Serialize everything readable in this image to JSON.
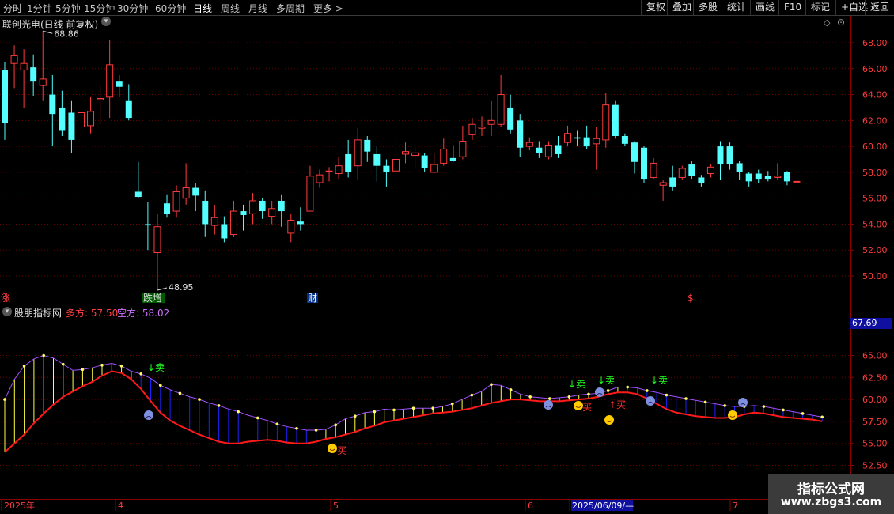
{
  "toolbar": {
    "periods": [
      "分时",
      "1分钟",
      "5分钟",
      "15分钟",
      "30分钟",
      "60分钟",
      "日线",
      "周线",
      "月线",
      "多周期",
      "更多 >"
    ],
    "active_period": "日线",
    "tools": [
      "复权",
      "叠加",
      "多股",
      "统计",
      "画线",
      "F10",
      "标记",
      "+自选",
      "返回"
    ]
  },
  "price_panel": {
    "title": "联创光电(日线 前复权)",
    "high_marker": "68.86",
    "low_marker": "48.95",
    "event_tags": [
      {
        "text": "涨",
        "color": "#ff3c3c"
      },
      {
        "text": "跌增",
        "color": "#e0e0e0"
      },
      {
        "text": "财",
        "color": "#ffffff"
      },
      {
        "text": "$",
        "color": "#ff3c3c"
      }
    ],
    "y_ticks": [
      "68.00",
      "66.00",
      "64.00",
      "62.00",
      "60.00",
      "58.00",
      "56.00",
      "54.00",
      "52.00",
      "50.00"
    ],
    "up_color": "#ff3c3c",
    "down_color": "#54ffff"
  },
  "indicator_panel": {
    "name": "股朋指标网",
    "long_label": "多方: 57.50",
    "short_label": "空方: 58.02",
    "current_value": "67.69",
    "y_ticks": [
      "65.00",
      "62.50",
      "60.00",
      "57.50",
      "55.00",
      "52.50"
    ],
    "buy_label": "买",
    "sell_label": "卖",
    "long_color": "#ff1a1a",
    "short_color": "#a050ff"
  },
  "date_axis": {
    "labels": [
      "2025年",
      "4",
      "5",
      "6",
      "2025/06/09/—",
      "7"
    ]
  },
  "watermark": {
    "line1": "指标公式网",
    "line2": "www.zbgs3.com"
  },
  "chart_data": {
    "type": "candlestick",
    "title": "联创光电(日线 前复权)",
    "ylim": [
      48.5,
      69.5
    ],
    "candles": [
      {
        "o": 65.9,
        "c": 61.8,
        "h": 66.5,
        "l": 60.5
      },
      {
        "o": 66.4,
        "c": 67.0,
        "h": 67.8,
        "l": 64.5
      },
      {
        "o": 65.9,
        "c": 66.4,
        "h": 67.5,
        "l": 63.0
      },
      {
        "o": 66.1,
        "c": 65.0,
        "h": 67.1,
        "l": 63.9
      },
      {
        "o": 64.7,
        "c": 65.2,
        "h": 68.9,
        "l": 63.5
      },
      {
        "o": 64.0,
        "c": 62.5,
        "h": 65.5,
        "l": 60.0
      },
      {
        "o": 63.0,
        "c": 61.2,
        "h": 64.3,
        "l": 60.8
      },
      {
        "o": 62.6,
        "c": 60.5,
        "h": 63.5,
        "l": 59.5
      },
      {
        "o": 61.5,
        "c": 62.6,
        "h": 63.5,
        "l": 60.5
      },
      {
        "o": 61.6,
        "c": 62.7,
        "h": 63.8,
        "l": 61.0
      },
      {
        "o": 63.6,
        "c": 63.7,
        "h": 64.7,
        "l": 61.7
      },
      {
        "o": 63.8,
        "c": 66.3,
        "h": 68.2,
        "l": 62.2
      },
      {
        "o": 65.0,
        "c": 64.6,
        "h": 65.5,
        "l": 63.8
      },
      {
        "o": 63.5,
        "c": 62.2,
        "h": 64.8,
        "l": 62.0
      },
      {
        "o": 56.5,
        "c": 56.1,
        "h": 58.8,
        "l": 56.0
      },
      {
        "o": 54.0,
        "c": 53.9,
        "h": 55.7,
        "l": 52.0
      },
      {
        "o": 51.8,
        "c": 53.8,
        "h": 54.8,
        "l": 48.9
      },
      {
        "o": 55.6,
        "c": 54.8,
        "h": 56.3,
        "l": 54.5
      },
      {
        "o": 55.0,
        "c": 56.5,
        "h": 57.0,
        "l": 54.5
      },
      {
        "o": 56.0,
        "c": 56.8,
        "h": 58.7,
        "l": 55.5
      },
      {
        "o": 56.8,
        "c": 56.2,
        "h": 57.2,
        "l": 55.0
      },
      {
        "o": 55.8,
        "c": 54.0,
        "h": 56.6,
        "l": 53.0
      },
      {
        "o": 53.9,
        "c": 54.5,
        "h": 55.5,
        "l": 53.2
      },
      {
        "o": 54.0,
        "c": 52.9,
        "h": 54.6,
        "l": 52.6
      },
      {
        "o": 53.2,
        "c": 55.0,
        "h": 55.8,
        "l": 53.0
      },
      {
        "o": 55.0,
        "c": 54.7,
        "h": 55.5,
        "l": 53.5
      },
      {
        "o": 54.8,
        "c": 55.8,
        "h": 56.4,
        "l": 54.0
      },
      {
        "o": 55.8,
        "c": 55.0,
        "h": 56.0,
        "l": 54.4
      },
      {
        "o": 54.6,
        "c": 55.2,
        "h": 55.8,
        "l": 54.0
      },
      {
        "o": 55.8,
        "c": 55.0,
        "h": 56.3,
        "l": 53.8
      },
      {
        "o": 53.3,
        "c": 54.3,
        "h": 54.8,
        "l": 52.6
      },
      {
        "o": 54.2,
        "c": 54.0,
        "h": 55.3,
        "l": 53.5
      },
      {
        "o": 55.0,
        "c": 57.7,
        "h": 58.5,
        "l": 55.0
      },
      {
        "o": 57.2,
        "c": 57.8,
        "h": 58.2,
        "l": 56.8
      },
      {
        "o": 58.1,
        "c": 58.1,
        "h": 58.4,
        "l": 57.3
      },
      {
        "o": 57.9,
        "c": 58.5,
        "h": 59.2,
        "l": 57.5
      },
      {
        "o": 59.4,
        "c": 58.0,
        "h": 60.5,
        "l": 57.6
      },
      {
        "o": 58.5,
        "c": 60.5,
        "h": 61.4,
        "l": 57.4
      },
      {
        "o": 60.5,
        "c": 59.6,
        "h": 60.8,
        "l": 58.8
      },
      {
        "o": 59.4,
        "c": 58.5,
        "h": 60.0,
        "l": 57.3
      },
      {
        "o": 58.5,
        "c": 58.0,
        "h": 59.0,
        "l": 56.9
      },
      {
        "o": 58.1,
        "c": 59.0,
        "h": 60.5,
        "l": 57.9
      },
      {
        "o": 59.4,
        "c": 59.6,
        "h": 60.3,
        "l": 58.7
      },
      {
        "o": 59.3,
        "c": 59.5,
        "h": 60.0,
        "l": 58.3
      },
      {
        "o": 59.3,
        "c": 58.3,
        "h": 59.5,
        "l": 58.0
      },
      {
        "o": 58.0,
        "c": 58.6,
        "h": 59.5,
        "l": 57.9
      },
      {
        "o": 58.7,
        "c": 59.8,
        "h": 60.6,
        "l": 58.5
      },
      {
        "o": 59.1,
        "c": 58.9,
        "h": 60.1,
        "l": 58.8
      },
      {
        "o": 59.2,
        "c": 60.4,
        "h": 61.6,
        "l": 59.0
      },
      {
        "o": 60.9,
        "c": 61.7,
        "h": 62.2,
        "l": 60.5
      },
      {
        "o": 61.4,
        "c": 61.5,
        "h": 62.3,
        "l": 60.8
      },
      {
        "o": 61.7,
        "c": 62.0,
        "h": 63.5,
        "l": 60.8
      },
      {
        "o": 61.7,
        "c": 64.0,
        "h": 65.5,
        "l": 61.5
      },
      {
        "o": 63.0,
        "c": 61.3,
        "h": 64.0,
        "l": 61.0
      },
      {
        "o": 62.0,
        "c": 59.9,
        "h": 62.5,
        "l": 59.2
      },
      {
        "o": 60.0,
        "c": 60.3,
        "h": 60.7,
        "l": 59.7
      },
      {
        "o": 59.9,
        "c": 59.5,
        "h": 60.4,
        "l": 59.1
      },
      {
        "o": 59.2,
        "c": 60.1,
        "h": 60.4,
        "l": 59.0
      },
      {
        "o": 60.1,
        "c": 59.4,
        "h": 60.8,
        "l": 59.1
      },
      {
        "o": 60.3,
        "c": 61.0,
        "h": 61.6,
        "l": 60.0
      },
      {
        "o": 60.7,
        "c": 60.6,
        "h": 61.2,
        "l": 60.0
      },
      {
        "o": 60.7,
        "c": 60.0,
        "h": 61.6,
        "l": 59.8
      },
      {
        "o": 60.2,
        "c": 60.6,
        "h": 61.5,
        "l": 58.2
      },
      {
        "o": 60.5,
        "c": 63.2,
        "h": 64.1,
        "l": 59.9
      },
      {
        "o": 63.2,
        "c": 60.8,
        "h": 63.5,
        "l": 60.6
      },
      {
        "o": 60.8,
        "c": 60.2,
        "h": 61.0,
        "l": 60.0
      },
      {
        "o": 60.3,
        "c": 58.8,
        "h": 60.4,
        "l": 57.9
      },
      {
        "o": 59.9,
        "c": 57.5,
        "h": 60.0,
        "l": 57.2
      },
      {
        "o": 57.6,
        "c": 58.7,
        "h": 59.1,
        "l": 57.5
      },
      {
        "o": 57.0,
        "c": 57.2,
        "h": 57.4,
        "l": 55.8
      },
      {
        "o": 57.6,
        "c": 56.9,
        "h": 58.5,
        "l": 56.6
      },
      {
        "o": 57.6,
        "c": 58.3,
        "h": 58.5,
        "l": 57.4
      },
      {
        "o": 58.6,
        "c": 57.7,
        "h": 58.9,
        "l": 57.5
      },
      {
        "o": 57.6,
        "c": 57.2,
        "h": 57.8,
        "l": 56.9
      },
      {
        "o": 57.9,
        "c": 58.4,
        "h": 58.6,
        "l": 57.6
      },
      {
        "o": 60.0,
        "c": 58.6,
        "h": 60.4,
        "l": 57.4
      },
      {
        "o": 60.0,
        "c": 58.6,
        "h": 60.3,
        "l": 58.2
      },
      {
        "o": 58.7,
        "c": 58.0,
        "h": 58.9,
        "l": 57.4
      },
      {
        "o": 57.9,
        "c": 57.3,
        "h": 58.0,
        "l": 56.9
      },
      {
        "o": 57.9,
        "c": 57.5,
        "h": 58.2,
        "l": 57.2
      },
      {
        "o": 57.7,
        "c": 57.5,
        "h": 58.1,
        "l": 57.3
      },
      {
        "o": 57.6,
        "c": 57.7,
        "h": 58.7,
        "l": 57.4
      },
      {
        "o": 58.0,
        "c": 57.3,
        "h": 58.1,
        "l": 57.0
      },
      {
        "o": 57.3,
        "c": 57.3,
        "h": 57.3,
        "l": 57.3
      }
    ],
    "long_line": [
      54.0,
      55.0,
      56.0,
      57.3,
      58.4,
      59.4,
      60.3,
      60.9,
      61.5,
      62.0,
      62.7,
      63.2,
      63.0,
      62.3,
      61.2,
      59.8,
      58.5,
      57.6,
      57.0,
      56.5,
      56.0,
      55.6,
      55.2,
      55.0,
      55.0,
      55.2,
      55.3,
      55.4,
      55.3,
      55.1,
      55.0,
      55.0,
      55.2,
      55.5,
      55.7,
      56.0,
      56.3,
      56.7,
      57.0,
      57.4,
      57.6,
      57.8,
      58.0,
      58.2,
      58.4,
      58.5,
      58.6,
      58.8,
      59.0,
      59.3,
      59.6,
      59.8,
      60.0,
      60.0,
      59.9,
      59.8,
      59.8,
      59.8,
      59.9,
      60.0,
      60.1,
      60.3,
      60.6,
      60.8,
      60.8,
      60.6,
      60.1,
      59.5,
      58.9,
      58.5,
      58.3,
      58.1,
      58.0,
      57.9,
      57.9,
      58.0,
      58.3,
      58.5,
      58.4,
      58.2,
      58.0,
      57.9,
      57.8,
      57.7,
      57.5
    ],
    "short_line": [
      60.0,
      62.3,
      63.8,
      64.6,
      65.0,
      64.7,
      64.0,
      63.3,
      63.4,
      63.6,
      63.9,
      64.1,
      63.8,
      63.2,
      62.9,
      62.4,
      61.6,
      61.1,
      60.7,
      60.3,
      60.0,
      59.6,
      59.3,
      58.9,
      58.6,
      58.2,
      57.9,
      57.6,
      57.2,
      56.9,
      56.7,
      56.5,
      56.5,
      56.6,
      57.1,
      57.8,
      58.1,
      58.5,
      58.6,
      58.9,
      58.8,
      58.9,
      59.0,
      59.0,
      59.0,
      59.2,
      59.5,
      60.0,
      60.5,
      60.9,
      61.7,
      61.6,
      61.1,
      60.6,
      60.3,
      60.2,
      60.1,
      60.2,
      60.3,
      60.5,
      60.6,
      60.7,
      61.0,
      61.4,
      61.4,
      61.3,
      61.0,
      60.8,
      60.5,
      60.3,
      60.1,
      59.9,
      59.7,
      59.5,
      59.3,
      59.2,
      59.2,
      59.3,
      59.2,
      59.0,
      58.8,
      58.6,
      58.4,
      58.2,
      58.0
    ],
    "indicator_ylim": [
      52.0,
      68.5
    ]
  }
}
